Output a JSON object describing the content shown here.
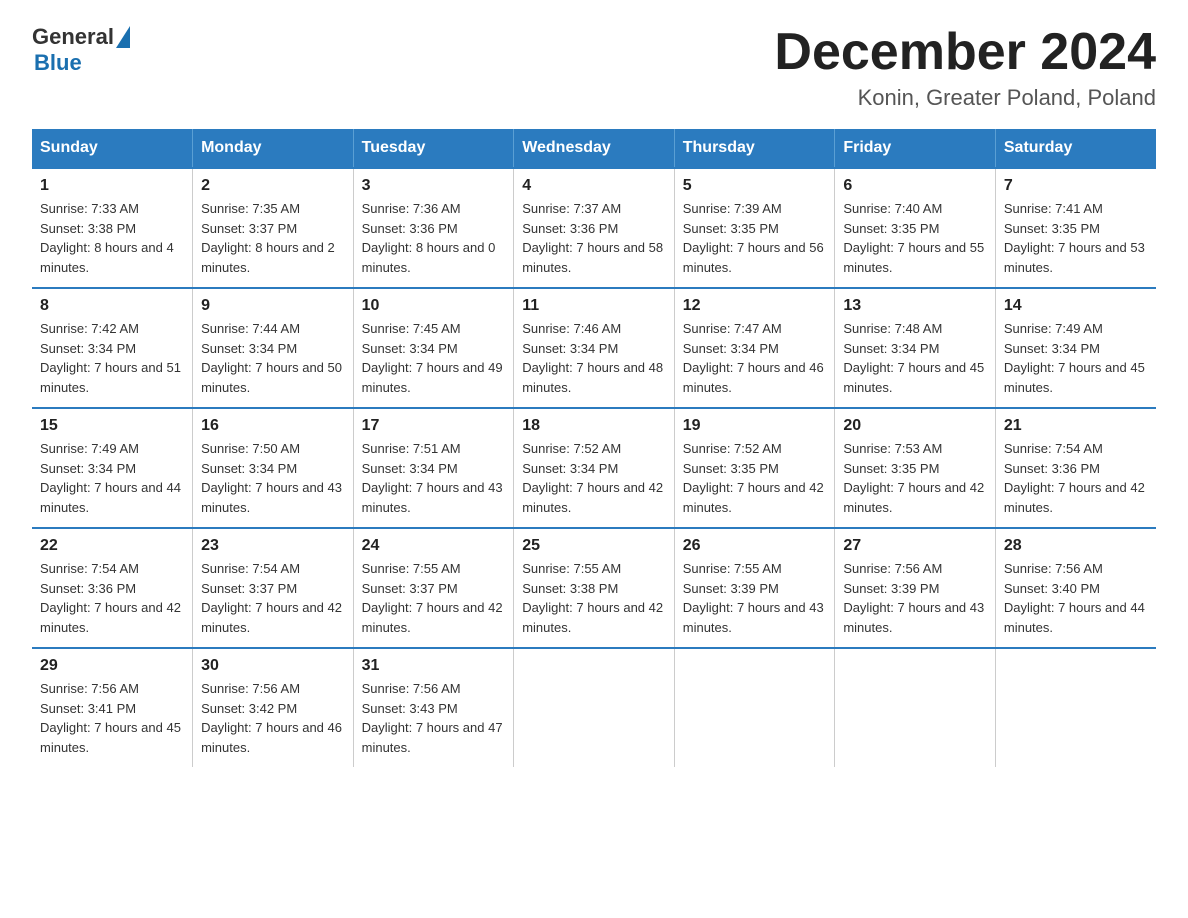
{
  "logo": {
    "general_text": "General",
    "blue_text": "Blue"
  },
  "header": {
    "month_year": "December 2024",
    "location": "Konin, Greater Poland, Poland"
  },
  "days_of_week": [
    "Sunday",
    "Monday",
    "Tuesday",
    "Wednesday",
    "Thursday",
    "Friday",
    "Saturday"
  ],
  "weeks": [
    [
      {
        "day": "1",
        "sunrise": "7:33 AM",
        "sunset": "3:38 PM",
        "daylight": "8 hours and 4 minutes."
      },
      {
        "day": "2",
        "sunrise": "7:35 AM",
        "sunset": "3:37 PM",
        "daylight": "8 hours and 2 minutes."
      },
      {
        "day": "3",
        "sunrise": "7:36 AM",
        "sunset": "3:36 PM",
        "daylight": "8 hours and 0 minutes."
      },
      {
        "day": "4",
        "sunrise": "7:37 AM",
        "sunset": "3:36 PM",
        "daylight": "7 hours and 58 minutes."
      },
      {
        "day": "5",
        "sunrise": "7:39 AM",
        "sunset": "3:35 PM",
        "daylight": "7 hours and 56 minutes."
      },
      {
        "day": "6",
        "sunrise": "7:40 AM",
        "sunset": "3:35 PM",
        "daylight": "7 hours and 55 minutes."
      },
      {
        "day": "7",
        "sunrise": "7:41 AM",
        "sunset": "3:35 PM",
        "daylight": "7 hours and 53 minutes."
      }
    ],
    [
      {
        "day": "8",
        "sunrise": "7:42 AM",
        "sunset": "3:34 PM",
        "daylight": "7 hours and 51 minutes."
      },
      {
        "day": "9",
        "sunrise": "7:44 AM",
        "sunset": "3:34 PM",
        "daylight": "7 hours and 50 minutes."
      },
      {
        "day": "10",
        "sunrise": "7:45 AM",
        "sunset": "3:34 PM",
        "daylight": "7 hours and 49 minutes."
      },
      {
        "day": "11",
        "sunrise": "7:46 AM",
        "sunset": "3:34 PM",
        "daylight": "7 hours and 48 minutes."
      },
      {
        "day": "12",
        "sunrise": "7:47 AM",
        "sunset": "3:34 PM",
        "daylight": "7 hours and 46 minutes."
      },
      {
        "day": "13",
        "sunrise": "7:48 AM",
        "sunset": "3:34 PM",
        "daylight": "7 hours and 45 minutes."
      },
      {
        "day": "14",
        "sunrise": "7:49 AM",
        "sunset": "3:34 PM",
        "daylight": "7 hours and 45 minutes."
      }
    ],
    [
      {
        "day": "15",
        "sunrise": "7:49 AM",
        "sunset": "3:34 PM",
        "daylight": "7 hours and 44 minutes."
      },
      {
        "day": "16",
        "sunrise": "7:50 AM",
        "sunset": "3:34 PM",
        "daylight": "7 hours and 43 minutes."
      },
      {
        "day": "17",
        "sunrise": "7:51 AM",
        "sunset": "3:34 PM",
        "daylight": "7 hours and 43 minutes."
      },
      {
        "day": "18",
        "sunrise": "7:52 AM",
        "sunset": "3:34 PM",
        "daylight": "7 hours and 42 minutes."
      },
      {
        "day": "19",
        "sunrise": "7:52 AM",
        "sunset": "3:35 PM",
        "daylight": "7 hours and 42 minutes."
      },
      {
        "day": "20",
        "sunrise": "7:53 AM",
        "sunset": "3:35 PM",
        "daylight": "7 hours and 42 minutes."
      },
      {
        "day": "21",
        "sunrise": "7:54 AM",
        "sunset": "3:36 PM",
        "daylight": "7 hours and 42 minutes."
      }
    ],
    [
      {
        "day": "22",
        "sunrise": "7:54 AM",
        "sunset": "3:36 PM",
        "daylight": "7 hours and 42 minutes."
      },
      {
        "day": "23",
        "sunrise": "7:54 AM",
        "sunset": "3:37 PM",
        "daylight": "7 hours and 42 minutes."
      },
      {
        "day": "24",
        "sunrise": "7:55 AM",
        "sunset": "3:37 PM",
        "daylight": "7 hours and 42 minutes."
      },
      {
        "day": "25",
        "sunrise": "7:55 AM",
        "sunset": "3:38 PM",
        "daylight": "7 hours and 42 minutes."
      },
      {
        "day": "26",
        "sunrise": "7:55 AM",
        "sunset": "3:39 PM",
        "daylight": "7 hours and 43 minutes."
      },
      {
        "day": "27",
        "sunrise": "7:56 AM",
        "sunset": "3:39 PM",
        "daylight": "7 hours and 43 minutes."
      },
      {
        "day": "28",
        "sunrise": "7:56 AM",
        "sunset": "3:40 PM",
        "daylight": "7 hours and 44 minutes."
      }
    ],
    [
      {
        "day": "29",
        "sunrise": "7:56 AM",
        "sunset": "3:41 PM",
        "daylight": "7 hours and 45 minutes."
      },
      {
        "day": "30",
        "sunrise": "7:56 AM",
        "sunset": "3:42 PM",
        "daylight": "7 hours and 46 minutes."
      },
      {
        "day": "31",
        "sunrise": "7:56 AM",
        "sunset": "3:43 PM",
        "daylight": "7 hours and 47 minutes."
      },
      null,
      null,
      null,
      null
    ]
  ],
  "labels": {
    "sunrise_prefix": "Sunrise: ",
    "sunset_prefix": "Sunset: ",
    "daylight_prefix": "Daylight: "
  }
}
